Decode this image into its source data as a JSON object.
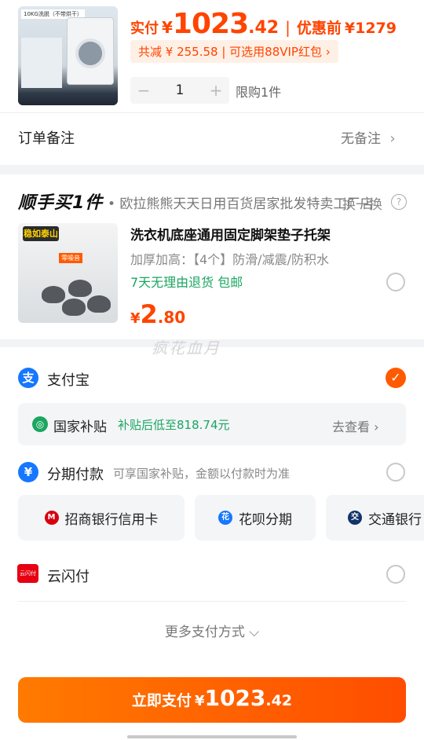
{
  "product": {
    "thumb_tag": "10KG洗脱（不带烘干）",
    "price_label": "实付",
    "currency": "¥",
    "price_int": "1023",
    "price_dec": ".42",
    "separator": "|",
    "original_label": "优惠前",
    "original_price": "¥1279",
    "discount_text": "共减 ¥ 255.58 | 可选用88VIP红包 ›",
    "quantity": "1",
    "minus": "−",
    "plus": "+",
    "limit_text": "限购1件"
  },
  "order_note": {
    "label": "订单备注",
    "value": "无备注",
    "chevron": "›"
  },
  "upsell": {
    "header": "顺手买1件",
    "store": "• 欧拉熊熊天天日用百货居家批发特卖工厂店",
    "swap": "换一换",
    "help": "?",
    "badge": "稳如泰山",
    "sub_badge": "零噪音",
    "title": "洗衣机底座通用固定脚架垫子托架",
    "spec": "加厚加高：【4个】防滑/减震/防积水",
    "promo": "7天无理由退货  包邮",
    "currency": "¥",
    "price_int": "2",
    "price_dec": ".80"
  },
  "watermark": "疯花血月",
  "payment": {
    "alipay": {
      "icon": "支",
      "label": "支付宝",
      "check": "✓"
    },
    "subsidy": {
      "icon": "◎",
      "title": "国家补贴",
      "note": "补贴后低至818.74元",
      "link": "去查看 ›"
    },
    "installment": {
      "icon": "¥",
      "label": "分期付款",
      "sub": "可享国家补贴，金额以付款时为准"
    },
    "banks": [
      {
        "name": "招商银行信用卡",
        "logo": "M",
        "color": "#d7000f"
      },
      {
        "name": "花呗分期",
        "logo": "花",
        "color": "#1677ff"
      },
      {
        "name": "交通银行",
        "logo": "交",
        "color": "#12336b"
      }
    ],
    "unionpay": {
      "icon": "云闪付",
      "label": "云闪付"
    },
    "more": "更多支付方式 ⌵"
  },
  "pay_button": {
    "label": "立即支付",
    "currency": "¥",
    "amount_int": "1023",
    "amount_dec": ".42"
  },
  "colors": {
    "accent": "#ff4400",
    "green": "#1aa661",
    "alipay": "#1677ff"
  }
}
